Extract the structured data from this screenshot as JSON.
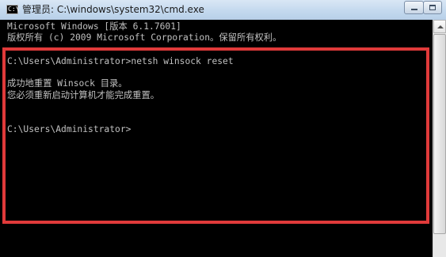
{
  "window": {
    "title": "管理员: C:\\windows\\system32\\cmd.exe",
    "icon_label": "C:\\",
    "icon": "cmd-icon"
  },
  "console": {
    "lines": [
      "Microsoft Windows [版本 6.1.7601]",
      "版权所有 (c) 2009 Microsoft Corporation。保留所有权利。",
      "",
      "C:\\Users\\Administrator>netsh winsock reset",
      "",
      "成功地重置 Winsock 目录。",
      "您必须重新启动计算机才能完成重置。",
      "",
      "",
      "C:\\Users\\Administrator>"
    ],
    "foreground_color": "#c0c0c0",
    "background_color": "#000000"
  },
  "highlight_color": "#e03a3a"
}
